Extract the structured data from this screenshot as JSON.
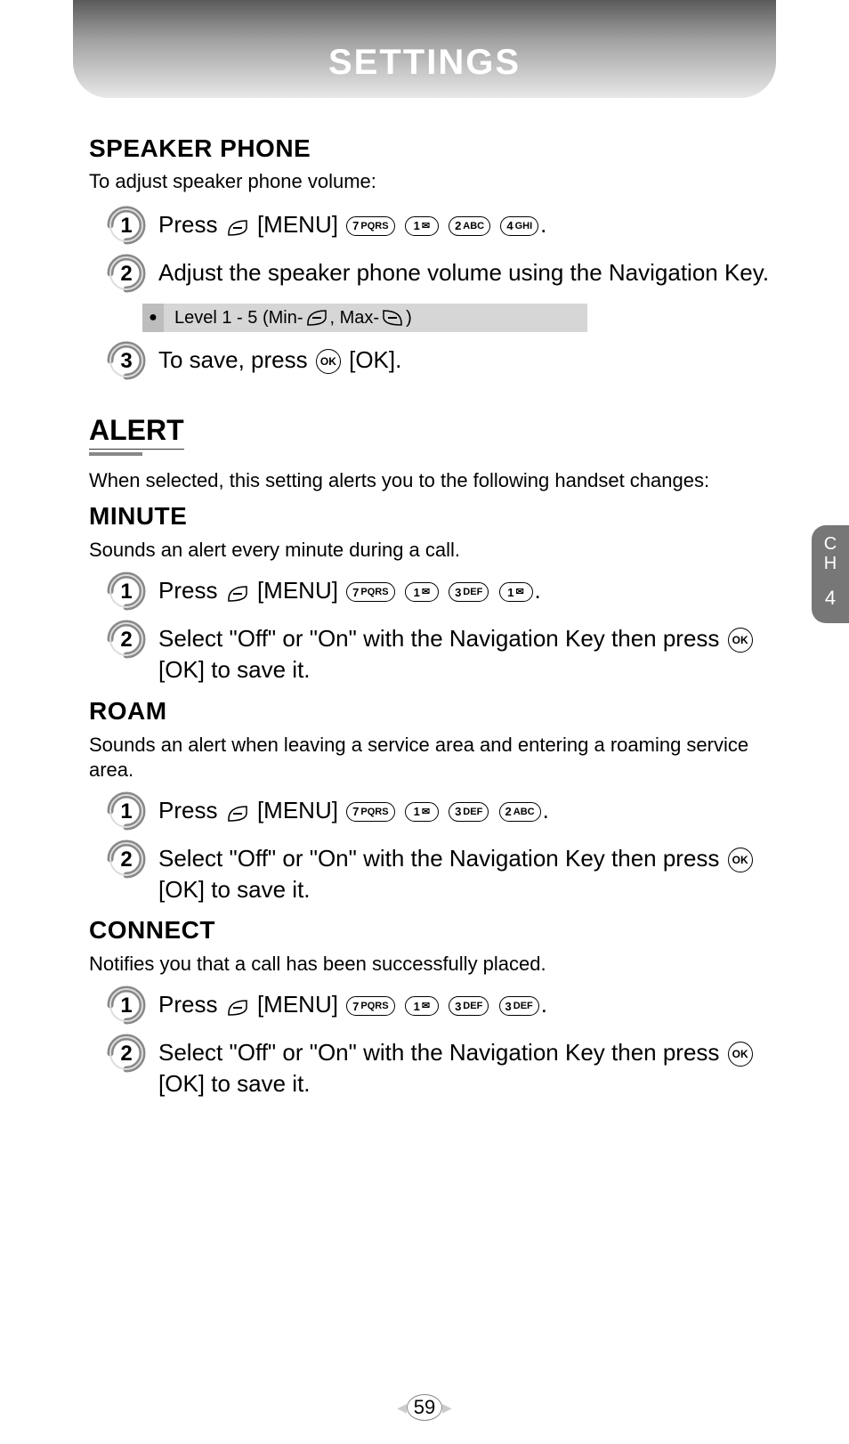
{
  "header": {
    "title": "SETTINGS"
  },
  "side_tab": {
    "line1": "C",
    "line2": "H",
    "num": "4"
  },
  "page_number": "59",
  "keys": {
    "menu": "[MENU]",
    "ok": "OK",
    "ok_bracket": "[OK]",
    "k7": {
      "d": "7",
      "s": "PQRS"
    },
    "k1": {
      "d": "1",
      "s": ""
    },
    "k2": {
      "d": "2",
      "s": "ABC"
    },
    "k3": {
      "d": "3",
      "s": "DEF"
    },
    "k4": {
      "d": "4",
      "s": "GHI"
    }
  },
  "speaker": {
    "title": "SPEAKER PHONE",
    "sub": "To adjust speaker phone volume:",
    "s1_a": "Press",
    "s1_b": ".",
    "s2": "Adjust the speaker phone volume using the Navigation Key.",
    "note_a": "Level 1 - 5 (Min-",
    "note_b": ", Max-",
    "note_c": ")",
    "s3_a": "To save, press",
    "s3_b": "."
  },
  "alert": {
    "title": "ALERT",
    "desc": "When selected, this setting alerts you to the following handset changes:"
  },
  "minute": {
    "title": "MINUTE",
    "desc": "Sounds an alert every minute during a call.",
    "s1_a": "Press",
    "s1_b": ".",
    "s2_a": "Select \"Off\" or \"On\" with the Navigation Key then press",
    "s2_b": "to save it."
  },
  "roam": {
    "title": "ROAM",
    "desc": "Sounds an alert when leaving a service area and entering a roaming service area.",
    "s1_a": "Press",
    "s1_b": ".",
    "s2_a": "Select \"Off\" or \"On\" with the Navigation Key then press",
    "s2_b": "to save it."
  },
  "connect": {
    "title": "CONNECT",
    "desc": "Notifies you that a call has been successfully placed.",
    "s1_a": "Press",
    "s1_b": ".",
    "s2_a": "Select \"Off\" or \"On\" with the Navigation Key then press",
    "s2_b": "to save it."
  }
}
